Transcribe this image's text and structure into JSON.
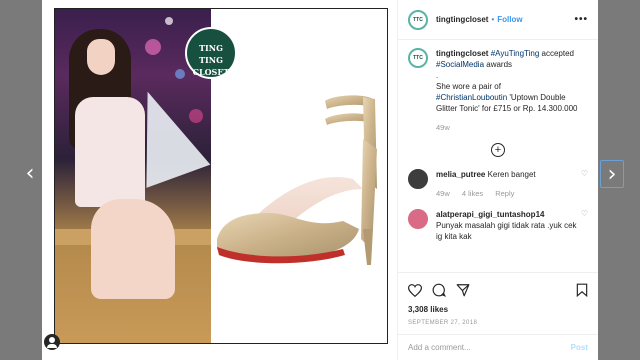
{
  "post": {
    "username": "tingtingcloset",
    "follow_label": "Follow",
    "separator": "•",
    "more_label": "•••",
    "badge_text": "TING TING\nCLOSET",
    "avatar_text": "TTC"
  },
  "caption": {
    "username": "tingtingcloset",
    "line1_tag": "#AyuTingTing",
    "line1_rest": " accepted",
    "line2_tag": "#SocialMedia",
    "line2_rest": " awards",
    "dot": ".",
    "line3": "She wore a pair of",
    "line4_tag": "#ChristianLouboutin",
    "line4_rest": " 'Uptown Double Glitter Tonic' for £715 or Rp. 14.300.000",
    "time": "49w"
  },
  "load_more_label": "+",
  "comments": [
    {
      "username": "melia_putree",
      "text": "Keren banget",
      "time": "49w",
      "likes": "4 likes",
      "reply": "Reply"
    },
    {
      "username": "alatperapi_gigi_tuntashop14",
      "text": "Punyak masalah gigi tidak rata .yuk cek ig kita kak"
    }
  ],
  "actions": {
    "likes_count": "3,308 likes",
    "date": "SEPTEMBER 27, 2018"
  },
  "add_comment": {
    "placeholder": "Add a comment...",
    "post_label": "Post"
  },
  "nav": {
    "prev": "‹",
    "next": "›"
  },
  "colors": {
    "link": "#003569",
    "follow": "#3897f0",
    "badge_bg": "#17503f",
    "overlay": "#7a7a7a"
  },
  "icons": [
    "heart-icon",
    "comment-icon",
    "share-icon",
    "bookmark-icon",
    "plus-circle-icon",
    "profile-icon",
    "chevron-left-icon",
    "chevron-right-icon",
    "heart-outline-icon"
  ]
}
